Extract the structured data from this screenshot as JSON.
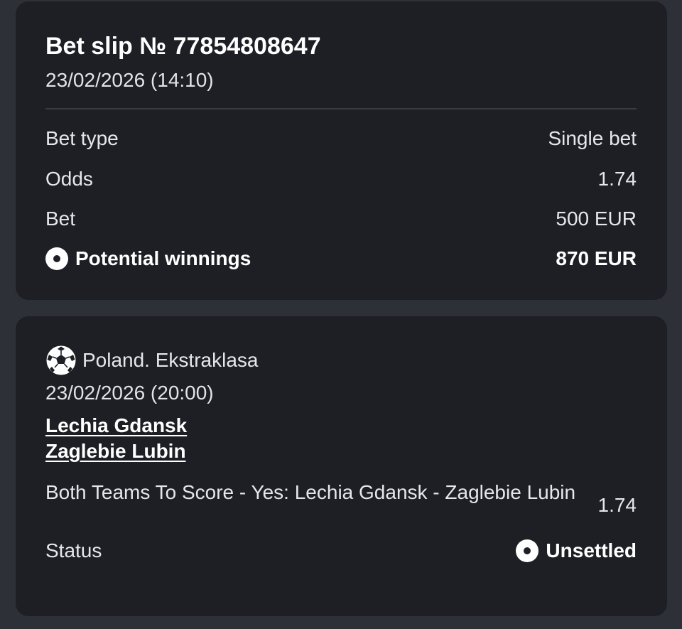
{
  "slip": {
    "title": "Bet slip № 77854808647",
    "date": "23/02/2026 (14:10)",
    "rows": [
      {
        "label": "Bet type",
        "value": "Single bet"
      },
      {
        "label": "Odds",
        "value": "1.74"
      },
      {
        "label": "Bet",
        "value": "500 EUR"
      }
    ],
    "potential_label": "Potential winnings",
    "potential_value": "870 EUR",
    "potential_icon": "radio-dot-icon"
  },
  "event": {
    "sport_icon": "soccer-ball-icon",
    "league": "Poland. Ekstraklasa",
    "date": "23/02/2026 (20:00)",
    "home_team": "Lechia Gdansk",
    "away_team": "Zaglebie Lubin",
    "market": "Both Teams To Score - Yes: Lechia Gdansk - Zaglebie Lubin",
    "odds": "1.74",
    "status_label": "Status",
    "status_value": "Unsettled",
    "status_icon": "radio-dot-icon"
  },
  "colors": {
    "background": "#2e3038",
    "card": "#1e1f25",
    "text": "#e6e7ea",
    "emphasis": "#ffffff"
  }
}
